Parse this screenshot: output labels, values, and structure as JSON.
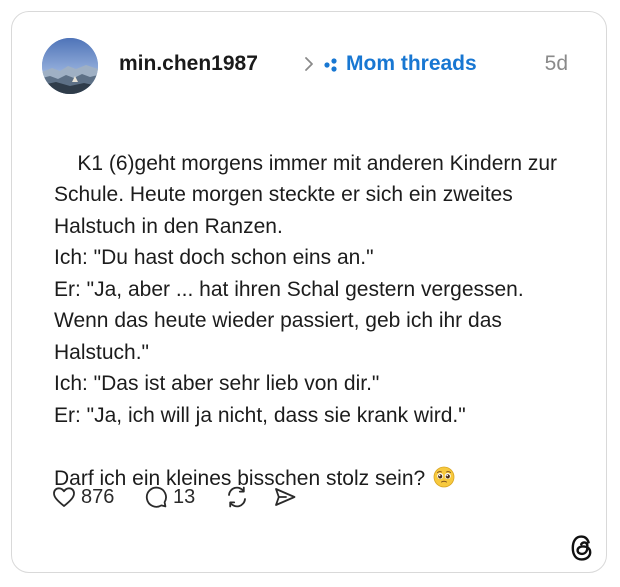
{
  "post": {
    "author": {
      "username": "min.chen1987",
      "avatar_icon": "landscape-photo-avatar"
    },
    "topic": {
      "label": "Mom threads",
      "icon": "topic-dots-icon",
      "color": "#1877d2"
    },
    "timestamp": "5d",
    "body_lines": [
      "K1 (6)geht morgens immer mit anderen Kindern zur",
      "Schule. Heute morgen steckte er sich ein zweites",
      "Halstuch in den Ranzen.",
      "Ich: \"Du hast doch schon eins an.\"",
      "Er: \"Ja, aber ... hat ihren Schal gestern vergessen.",
      "Wenn das heute wieder passiert, geb ich ihr das",
      "Halstuch.\"",
      "Ich: \"Das ist aber sehr lieb von dir.\"",
      "Er: \"Ja, ich will ja nicht, dass sie krank wird.\"",
      "",
      "Darf ich ein kleines bisschen stolz sein?"
    ],
    "trailing_emoji": "pleading-face-emoji",
    "actions": {
      "likes": "876",
      "replies": "13",
      "repost_icon": "repost-icon",
      "share_icon": "share-icon"
    },
    "brand_icon": "threads-logo-icon"
  }
}
